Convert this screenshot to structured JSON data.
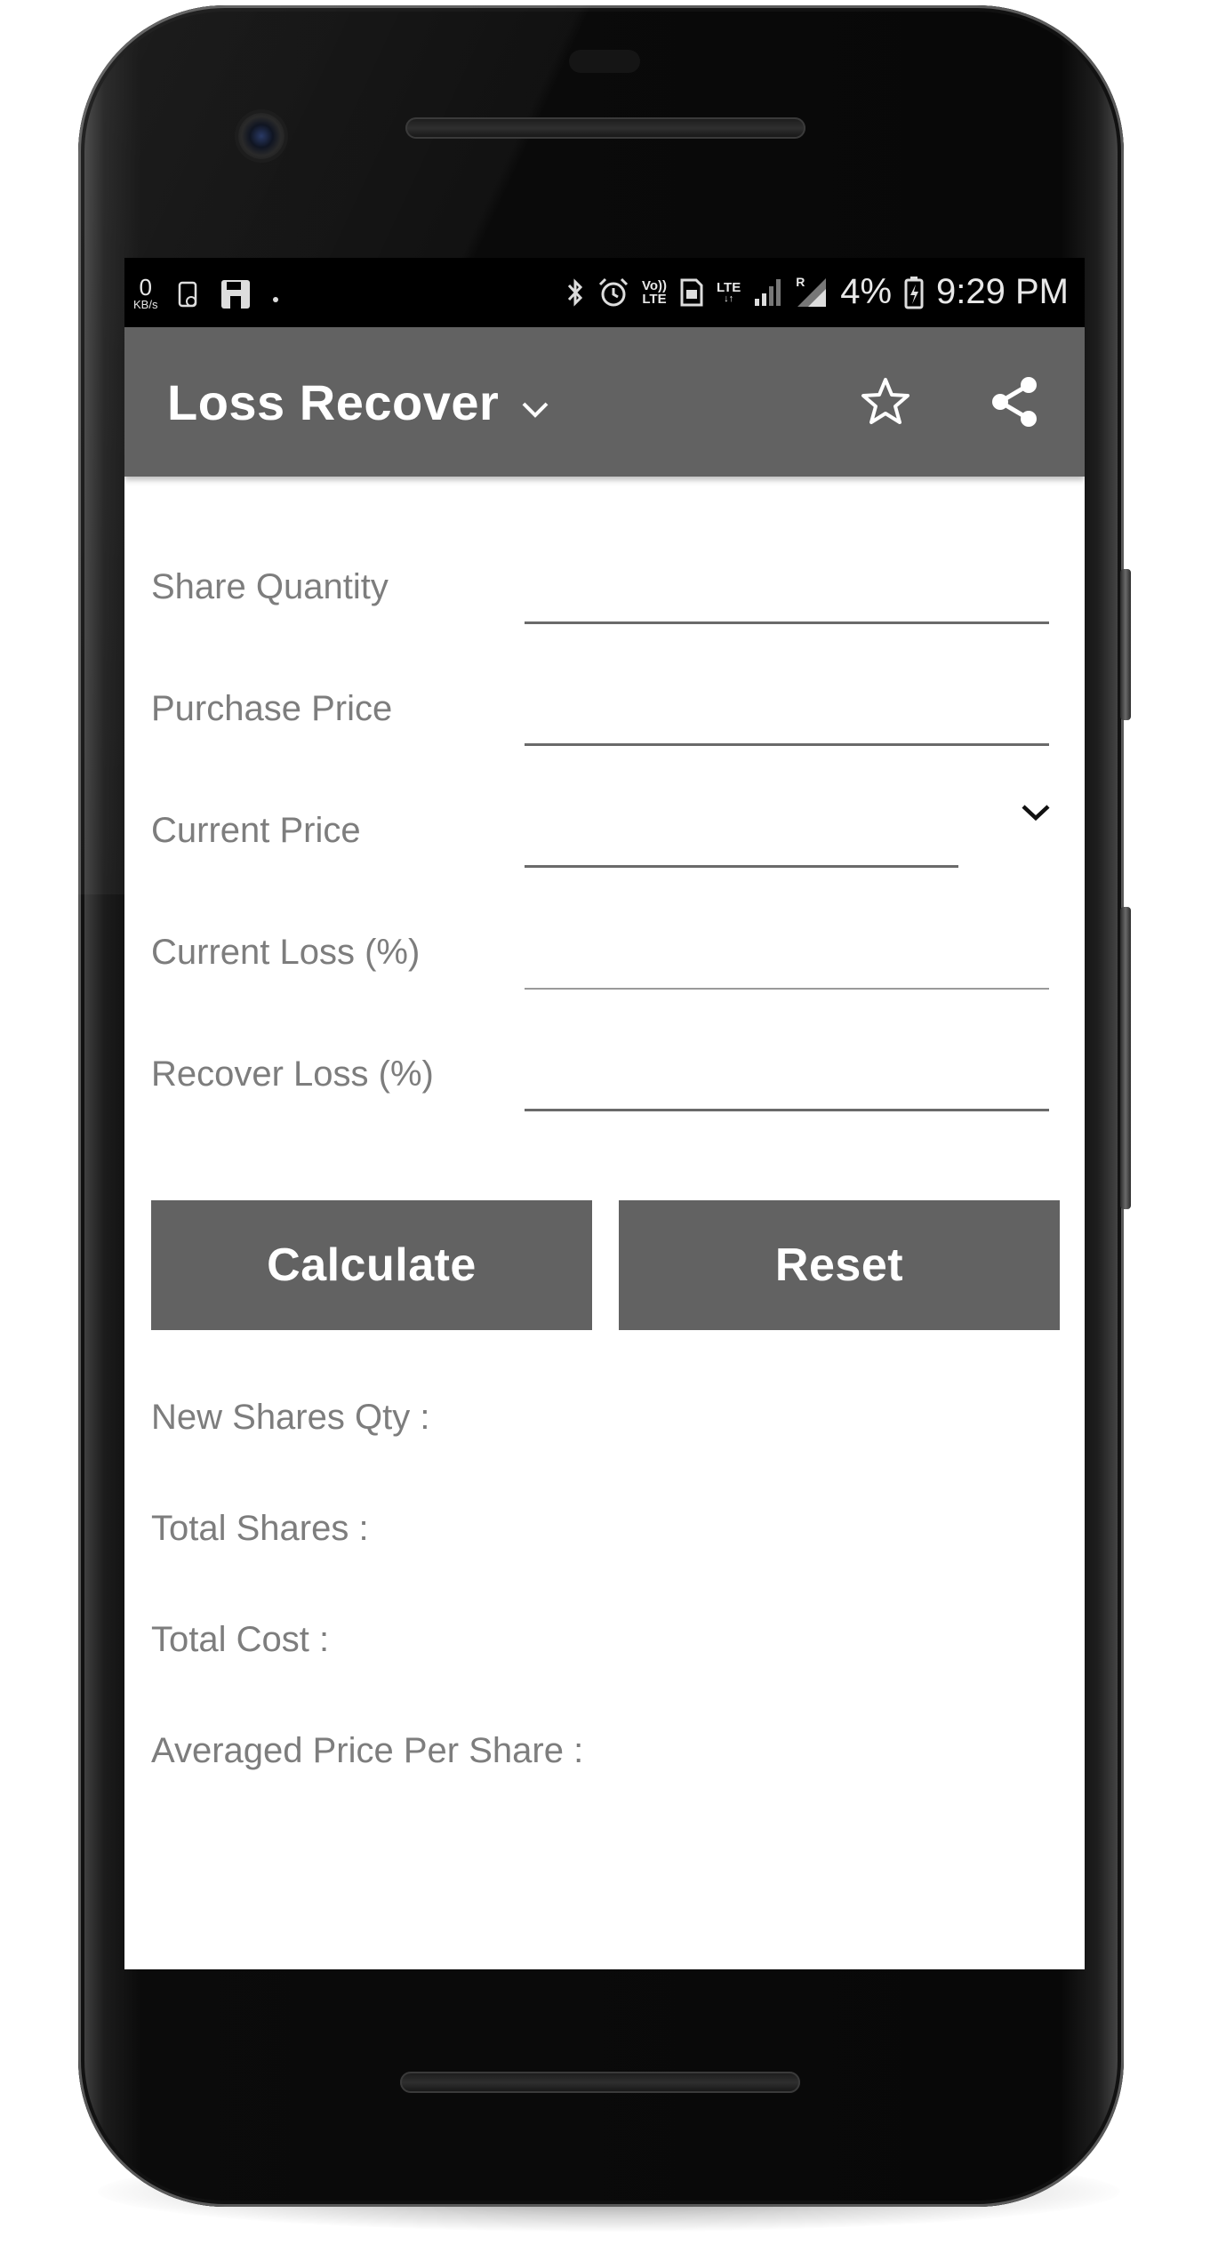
{
  "status_bar": {
    "speed_value": "0",
    "speed_unit": "KB/s",
    "volte_label_top": "Vo))",
    "volte_label_bottom": "LTE",
    "lte_label": "LTE",
    "roaming_label": "R",
    "battery_percent": "4%",
    "time": "9:29 PM"
  },
  "app_bar": {
    "title": "Loss Recover"
  },
  "form": {
    "share_quantity_label": "Share Quantity",
    "share_quantity_value": "",
    "purchase_price_label": "Purchase Price",
    "purchase_price_value": "",
    "current_price_label": "Current Price",
    "current_price_value": "",
    "current_loss_label": "Current Loss (%)",
    "current_loss_value": "",
    "recover_loss_label": "Recover Loss (%)",
    "recover_loss_value": ""
  },
  "buttons": {
    "calculate_label": "Calculate",
    "reset_label": "Reset"
  },
  "results": {
    "new_shares_qty_label": "New Shares Qty :",
    "total_shares_label": "Total Shares :",
    "total_cost_label": "Total Cost :",
    "averaged_price_label": "Averaged Price Per Share :"
  },
  "colors": {
    "app_bar": "#626262",
    "button": "#626262",
    "label_text": "#7d7d7d",
    "underline": "#6a6a6a"
  },
  "icons": {
    "title_dropdown": "chevron-down-icon",
    "favorite": "star-outline-icon",
    "share": "share-icon",
    "current_price_dropdown": "chevron-down-icon"
  }
}
